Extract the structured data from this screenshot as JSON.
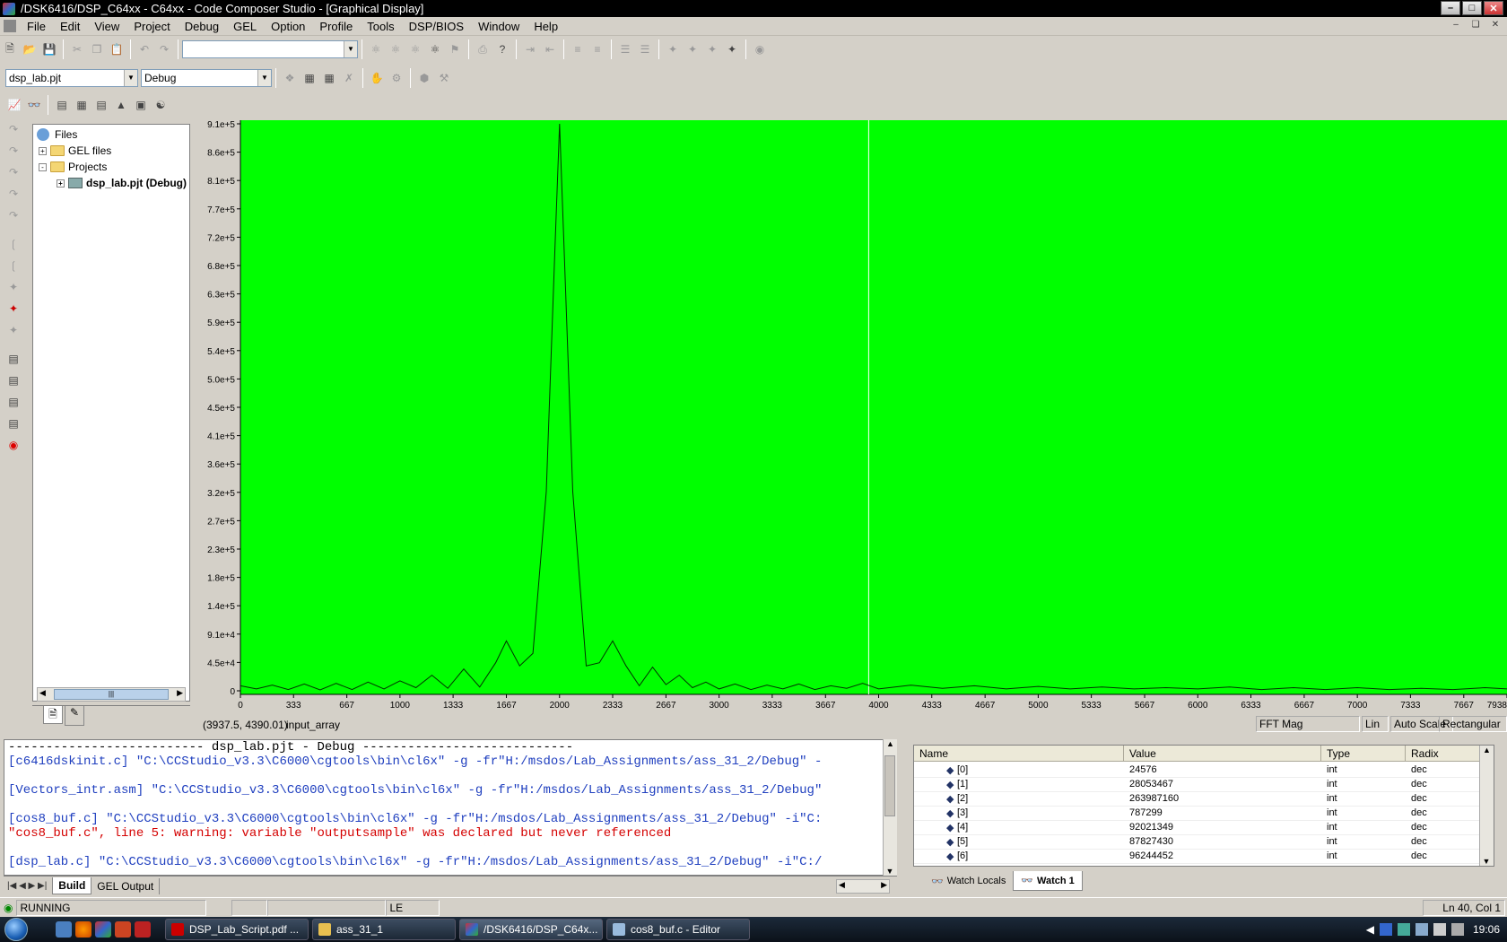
{
  "window": {
    "title": "/DSK6416/DSP_C64xx - C64xx - Code Composer Studio - [Graphical Display]"
  },
  "menu": [
    "File",
    "Edit",
    "View",
    "Project",
    "Debug",
    "GEL",
    "Option",
    "Profile",
    "Tools",
    "DSP/BIOS",
    "Window",
    "Help"
  ],
  "toolbar": {
    "search_combo": "",
    "project_combo": "dsp_lab.pjt",
    "config_combo": "Debug"
  },
  "project_tree": {
    "root": "Files",
    "items": [
      {
        "label": "GEL files",
        "expander": "+"
      },
      {
        "label": "Projects",
        "expander": "-"
      },
      {
        "label": "dsp_lab.pjt (Debug)",
        "expander": "+"
      }
    ]
  },
  "graph": {
    "status_coords": "(3937.5, 4390.01)",
    "status_name": "input_array",
    "display_type": "FFT Mag",
    "scale_lin": "Lin",
    "auto_scale": "Auto Scale",
    "window_type": "Rectangular",
    "background_color": "#00ff00",
    "cursor_x": 3937.5
  },
  "chart_data": {
    "type": "line",
    "title": "",
    "xlabel": "",
    "ylabel": "",
    "xlim": [
      0,
      7938
    ],
    "ylim": [
      0,
      910000
    ],
    "x_ticks": [
      "0",
      "333",
      "667",
      "1000",
      "1333",
      "1667",
      "2000",
      "2333",
      "2667",
      "3000",
      "3333",
      "3667",
      "4000",
      "4333",
      "4667",
      "5000",
      "5333",
      "5667",
      "6000",
      "6333",
      "6667",
      "7000",
      "7333",
      "7667",
      "7938"
    ],
    "y_ticks": [
      "9.1e+5",
      "8.6e+5",
      "8.1e+5",
      "7.7e+5",
      "7.2e+5",
      "6.8e+5",
      "6.3e+5",
      "5.9e+5",
      "5.4e+5",
      "5.0e+5",
      "4.5e+5",
      "4.1e+5",
      "3.6e+5",
      "3.2e+5",
      "2.7e+5",
      "2.3e+5",
      "1.8e+5",
      "1.4e+5",
      "9.1e+4",
      "4.5e+4",
      "0"
    ],
    "series": [
      {
        "x": [
          0,
          100,
          200,
          300,
          400,
          500,
          600,
          700,
          800,
          900,
          1000,
          1100,
          1200,
          1300,
          1400,
          1500,
          1600,
          1667,
          1750,
          1833,
          1917,
          1970,
          2000,
          2030,
          2083,
          2167,
          2250,
          2333,
          2417,
          2500,
          2583,
          2667,
          2750,
          2833,
          2917,
          3000,
          3100,
          3200,
          3300,
          3400,
          3500,
          3600,
          3700,
          3800,
          3900,
          4000,
          4200,
          4400,
          4600,
          4800,
          5000,
          5200,
          5400,
          5600,
          5800,
          6000,
          6200,
          6400,
          6600,
          6800,
          7000,
          7200,
          7400,
          7600,
          7800,
          7938
        ],
        "values": [
          8000,
          3000,
          9000,
          2000,
          11000,
          1500,
          12000,
          2000,
          14000,
          3000,
          16000,
          5000,
          25000,
          4000,
          35000,
          6000,
          45000,
          80000,
          40000,
          60000,
          320000,
          700000,
          910000,
          700000,
          320000,
          40000,
          45000,
          80000,
          40000,
          8000,
          38000,
          10000,
          25000,
          5000,
          14000,
          3000,
          11000,
          2000,
          9000,
          3000,
          11000,
          2000,
          8000,
          4000,
          12000,
          3000,
          9000,
          4000,
          8000,
          3000,
          7000,
          3000,
          6000,
          3000,
          5000,
          3000,
          6000,
          2000,
          5000,
          2000,
          5000,
          2000,
          4000,
          2000,
          5000,
          3000
        ]
      }
    ]
  },
  "output": {
    "header": "--------------------------  dsp_lab.pjt - Debug  ----------------------------",
    "lines": [
      {
        "tag": "[c6416dskinit.c]",
        "text": " \"C:\\CCStudio_v3.3\\C6000\\cgtools\\bin\\cl6x\" -g -fr\"H:/msdos/Lab_Assignments/ass_31_2/Debug\" -",
        "color": "#1f3fbf"
      },
      {
        "tag": "",
        "text": "",
        "color": "#000"
      },
      {
        "tag": "[Vectors_intr.asm]",
        "text": " \"C:\\CCStudio_v3.3\\C6000\\cgtools\\bin\\cl6x\" -g -fr\"H:/msdos/Lab_Assignments/ass_31_2/Debug\"",
        "color": "#1f3fbf"
      },
      {
        "tag": "",
        "text": "",
        "color": "#000"
      },
      {
        "tag": "[cos8_buf.c]",
        "text": " \"C:\\CCStudio_v3.3\\C6000\\cgtools\\bin\\cl6x\" -g -fr\"H:/msdos/Lab_Assignments/ass_31_2/Debug\" -i\"C:",
        "color": "#1f3fbf"
      },
      {
        "tag": "",
        "text": "\"cos8_buf.c\", line 5: warning: variable \"outputsample\" was declared but never referenced",
        "color": "#d40000"
      },
      {
        "tag": "",
        "text": "",
        "color": "#000"
      },
      {
        "tag": "[dsp_lab.c]",
        "text": " \"C:\\CCStudio_v3.3\\C6000\\cgtools\\bin\\cl6x\" -g -fr\"H:/msdos/Lab_Assignments/ass_31_2/Debug\" -i\"C:/",
        "color": "#1f3fbf"
      }
    ],
    "tabs": [
      "Build",
      "GEL Output"
    ]
  },
  "watch": {
    "columns": [
      "Name",
      "Value",
      "Type",
      "Radix"
    ],
    "rows": [
      {
        "name": "[0]",
        "value": "24576",
        "type": "int",
        "radix": "dec"
      },
      {
        "name": "[1]",
        "value": "28053467",
        "type": "int",
        "radix": "dec"
      },
      {
        "name": "[2]",
        "value": "263987160",
        "type": "int",
        "radix": "dec"
      },
      {
        "name": "[3]",
        "value": "787299",
        "type": "int",
        "radix": "dec"
      },
      {
        "name": "[4]",
        "value": "92021349",
        "type": "int",
        "radix": "dec"
      },
      {
        "name": "[5]",
        "value": "87827430",
        "type": "int",
        "radix": "dec"
      },
      {
        "name": "[6]",
        "value": "96244452",
        "type": "int",
        "radix": "dec"
      }
    ],
    "tabs": [
      "Watch Locals",
      "Watch 1"
    ]
  },
  "statusbar": {
    "state": "RUNNING",
    "endian": "LE",
    "position": "Ln 40, Col 1"
  },
  "taskbar": {
    "tasks": [
      "DSP_Lab_Script.pdf ...",
      "ass_31_1",
      "/DSK6416/DSP_C64x...",
      "cos8_buf.c - Editor"
    ],
    "clock": "19:06"
  }
}
